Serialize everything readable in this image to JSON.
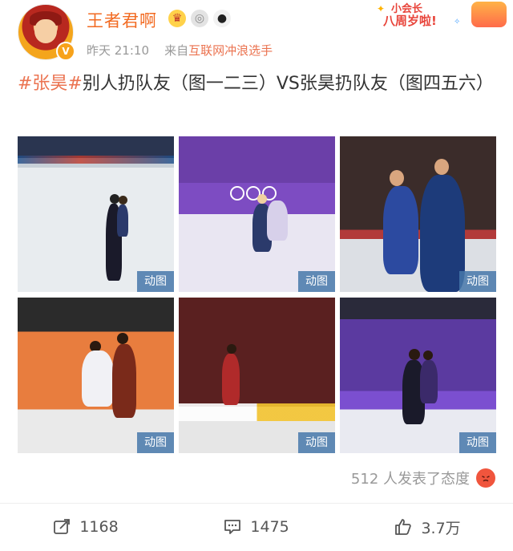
{
  "header": {
    "username": "王者君啊",
    "timestamp": "昨天 21:10",
    "source_prefix": "来自",
    "source": "互联网冲浪选手",
    "verified_badge": "V",
    "promo_line1": "小会长",
    "promo_line2": "八周岁啦!"
  },
  "post": {
    "hashtag": "#张昊#",
    "text": "别人扔队友（图一二三）VS张昊扔队友（图四五六）"
  },
  "images": [
    {
      "badge": "动图",
      "icon": "figure-skating-pair-1"
    },
    {
      "badge": "动图",
      "icon": "figure-skating-pair-2"
    },
    {
      "badge": "动图",
      "icon": "figure-skating-pair-3"
    },
    {
      "badge": "动图",
      "icon": "figure-skating-pair-4"
    },
    {
      "badge": "动图",
      "icon": "figure-skating-pair-5"
    },
    {
      "badge": "动图",
      "icon": "figure-skating-pair-6"
    }
  ],
  "reactions": {
    "text": "512 人发表了态度",
    "emoji": "angry-face-icon"
  },
  "actions": {
    "repost": "1168",
    "comment": "1475",
    "like": "3.7万"
  },
  "colors": {
    "username": "#f26a21",
    "hashtag": "#eb7350",
    "badge_bg": "#4678aa"
  }
}
